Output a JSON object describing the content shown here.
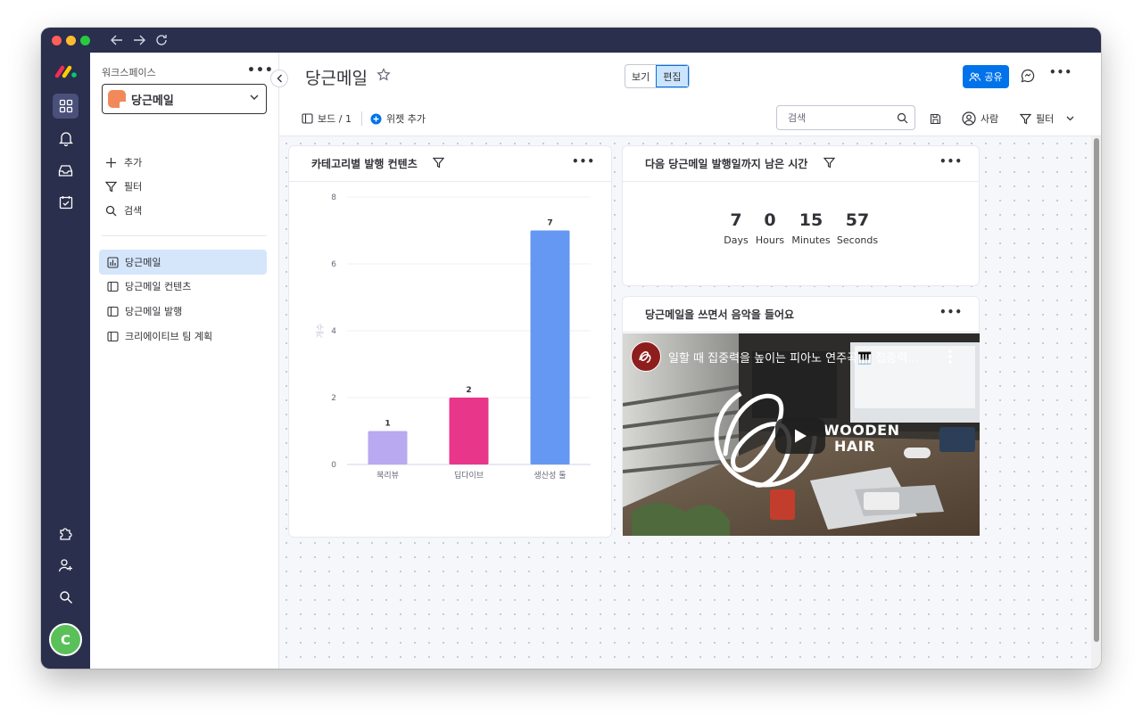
{
  "sidebar": {
    "workspace_label": "워크스페이스",
    "workspace_name": "당근메일",
    "actions": [
      {
        "label": "추가",
        "icon": "plus-icon"
      },
      {
        "label": "필터",
        "icon": "filter-icon"
      },
      {
        "label": "검색",
        "icon": "search-icon"
      }
    ],
    "boards": [
      {
        "label": "당근메일",
        "icon": "dashboard-icon",
        "active": true
      },
      {
        "label": "당근메일 컨텐츠",
        "icon": "board-icon",
        "active": false
      },
      {
        "label": "당근메일 발행",
        "icon": "board-icon",
        "active": false
      },
      {
        "label": "크리에이티브 팀 계획",
        "icon": "board-icon",
        "active": false
      }
    ]
  },
  "rail": {
    "avatar_initial": "C",
    "icons": [
      "grid-icon",
      "bell-icon",
      "inbox-icon",
      "calendar-check-icon",
      "puzzle-icon",
      "add-user-icon",
      "search-icon",
      "help-icon"
    ]
  },
  "header": {
    "title": "당근메일",
    "view_label": "보기",
    "edit_label": "편집",
    "share_label": "공유",
    "board_count": "보드 / 1",
    "add_widget": "위젯 추가",
    "search_placeholder": "검색",
    "people_label": "사람",
    "filter_label": "필터"
  },
  "widgets": {
    "chart": {
      "title": "카테고리별 발행 컨텐츠"
    },
    "countdown": {
      "title": "다음 당근메일 발행일까지 남은 시간",
      "units": [
        {
          "value": "7",
          "label": "Days"
        },
        {
          "value": "0",
          "label": "Hours"
        },
        {
          "value": "15",
          "label": "Minutes"
        },
        {
          "value": "57",
          "label": "Seconds"
        }
      ]
    },
    "video": {
      "title": "당근메일을 쓰면서 음악을 들어요",
      "video_title": "일할 때 집중력을 높이는 피아노 연주곡🎹 집중력...",
      "overlay_text_line1": "WOODEN",
      "overlay_text_line2": "HAIR"
    }
  },
  "chart_data": {
    "type": "bar",
    "categories": [
      "북리뷰",
      "딥다이브",
      "생산성 툴"
    ],
    "values": [
      1,
      2,
      7
    ],
    "colors": [
      "#b8a9f0",
      "#e8368a",
      "#6598f2"
    ],
    "ylabel": "개수",
    "ylim": [
      0,
      8
    ],
    "yticks": [
      0,
      2,
      4,
      6,
      8
    ],
    "grid": true
  }
}
